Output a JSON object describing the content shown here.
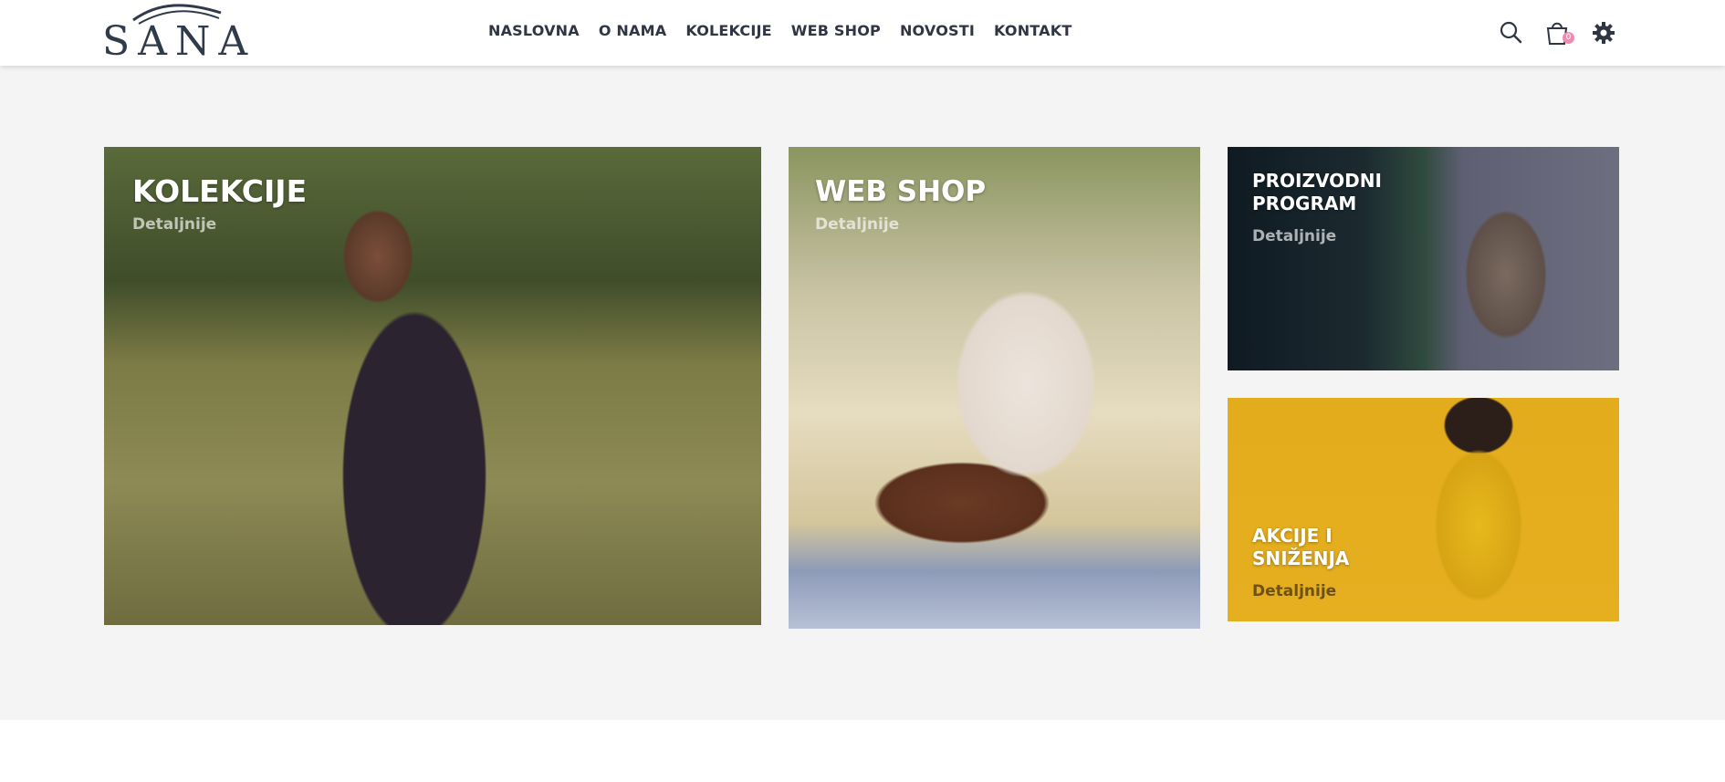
{
  "brand": {
    "logo_text": "SANA"
  },
  "nav": {
    "items": [
      "NASLOVNA",
      "O NAMA",
      "KOLEKCIJE",
      "WEB SHOP",
      "NOVOSTI",
      "KONTAKT"
    ]
  },
  "header_icons": {
    "search": "search-icon",
    "cart": "shopping-bag-icon",
    "settings": "gear-icon",
    "cart_count": "0"
  },
  "tiles": [
    {
      "title": "KOLEKCIJE",
      "link": "Detaljnije"
    },
    {
      "title": "WEB SHOP",
      "link": "Detaljnije"
    },
    {
      "title_line1": "PROIZVODNI",
      "title_line2": "PROGRAM",
      "link": "Detaljnije"
    },
    {
      "title_line1": "AKCIJE I",
      "title_line2": "SNIŽENJA",
      "link": "Detaljnije"
    }
  ],
  "colors": {
    "nav_text": "#2f3542",
    "page_bg": "#f4f4f4",
    "badge": "#f08bb0"
  }
}
